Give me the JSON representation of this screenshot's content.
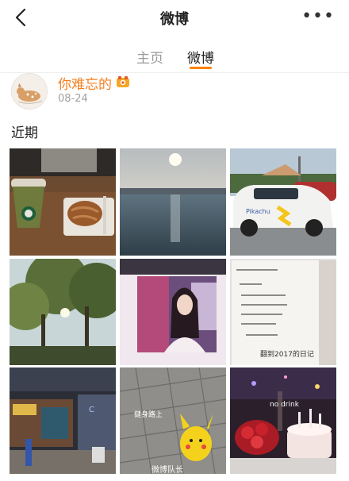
{
  "header": {
    "title": "微博",
    "back_icon": "chevron-left-icon",
    "more_icon": "more-dots-icon",
    "more_glyph": "•••"
  },
  "tabs": [
    {
      "label": "主页",
      "active": false
    },
    {
      "label": "微博",
      "active": true
    }
  ],
  "accent_color": "#ff8200",
  "post": {
    "username": "你难忘的",
    "date": "08-24",
    "badge_icon": "member-badge-icon"
  },
  "section_title": "近期",
  "photos": [
    {
      "name": "coffee-pastry"
    },
    {
      "name": "sunset-lake"
    },
    {
      "name": "pikachu-car"
    },
    {
      "name": "trees-sunlight"
    },
    {
      "name": "girl-portrait"
    },
    {
      "name": "handwritten-note",
      "overlay_text": "翻到2017的日记"
    },
    {
      "name": "street-night"
    },
    {
      "name": "pikachu-pavement",
      "overlay_text": "健身路上"
    },
    {
      "name": "cake-party",
      "overlay_text": "no drink"
    }
  ],
  "watermark": "微博队长"
}
